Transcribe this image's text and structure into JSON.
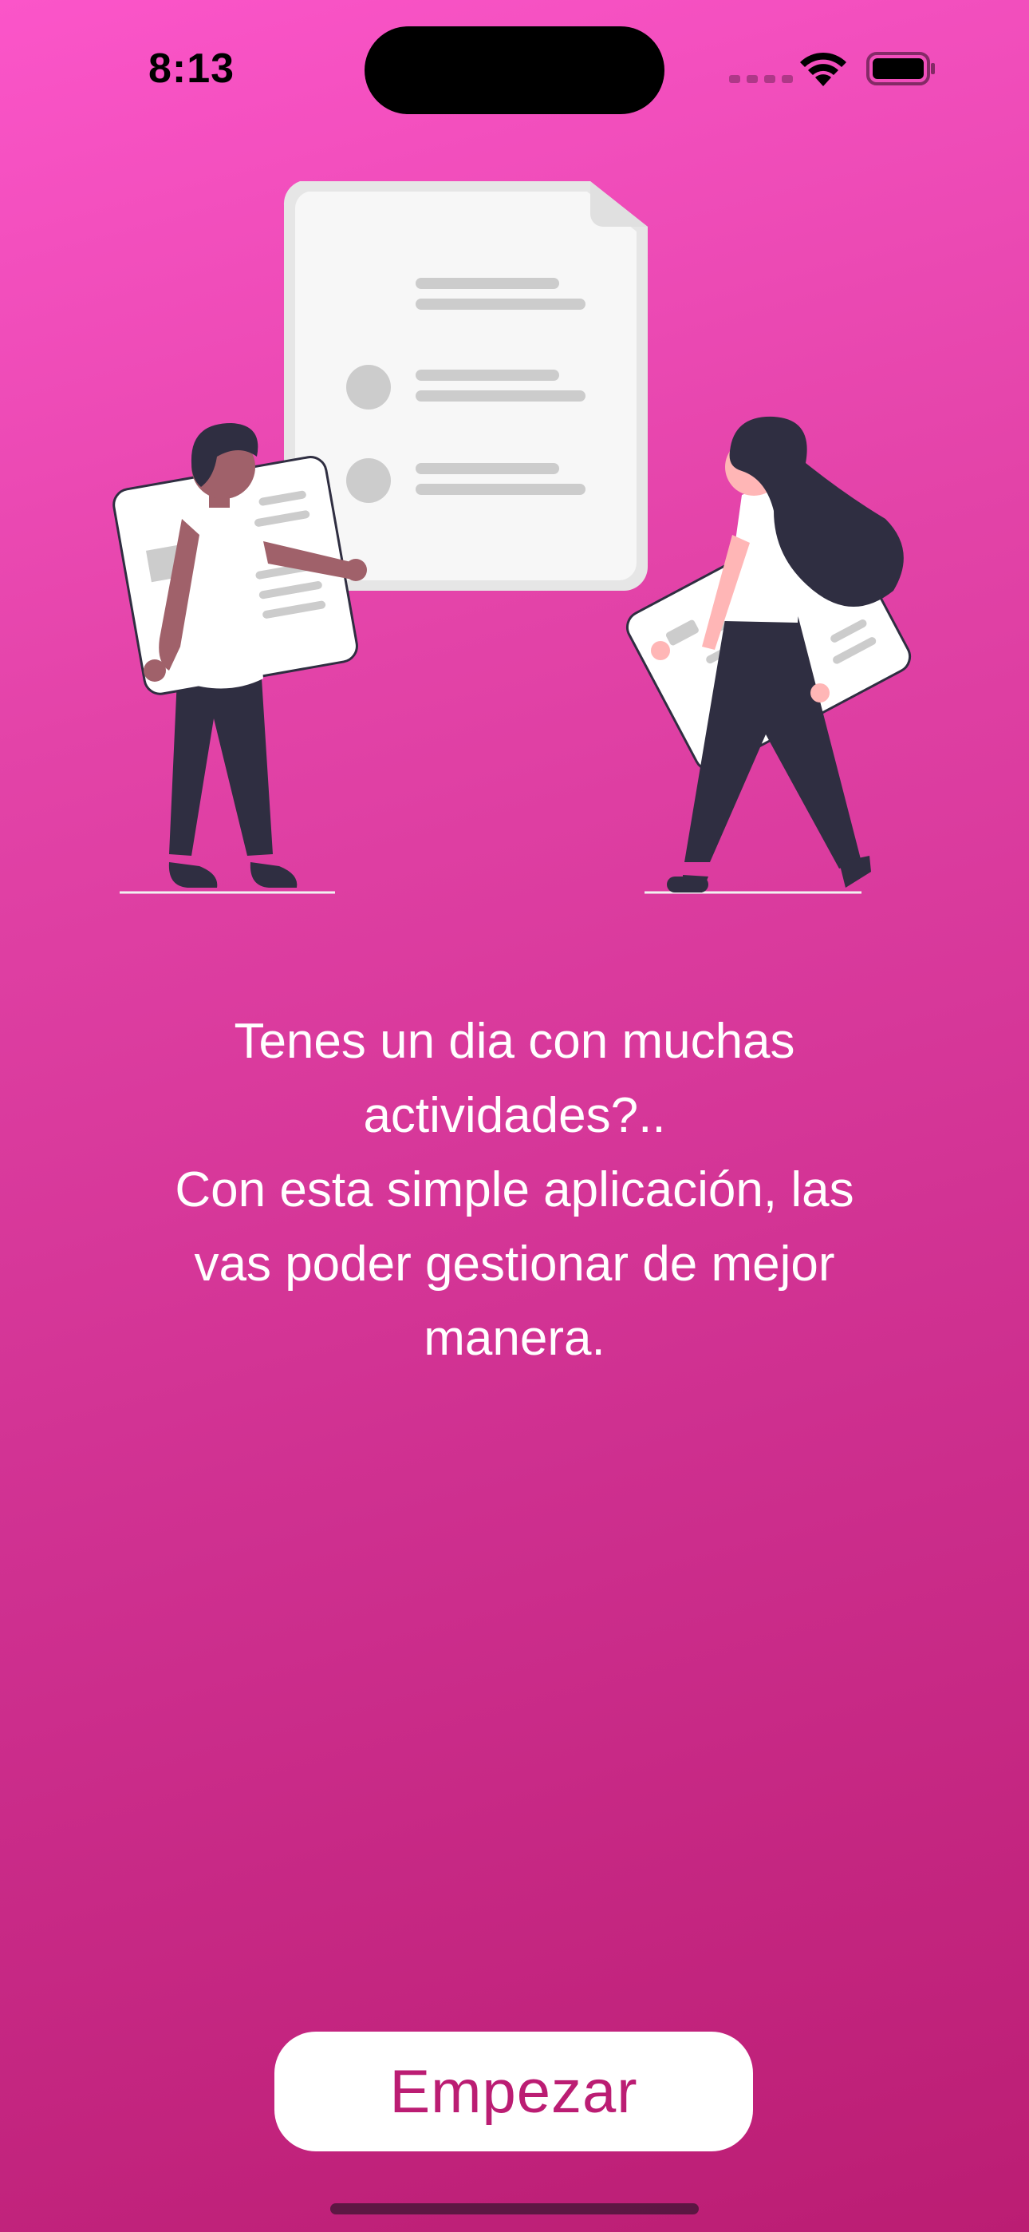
{
  "status_bar": {
    "time": "8:13"
  },
  "illustration": {
    "icon": "two-people-holding-documents-illustration"
  },
  "onboarding": {
    "message": "Tenes un dia con muchas\nactividades?..\nCon esta simple aplicación, las\nvas poder gestionar de mejor\nmanera.",
    "button_label": "Empezar"
  },
  "colors": {
    "gradient_top": "#fb55c9",
    "gradient_bottom": "#bb1d73",
    "button_text": "#bb1d73",
    "figure_dark": "#2f2e41",
    "document_white": "#f2f2f2",
    "document_lines": "#cccccc"
  }
}
